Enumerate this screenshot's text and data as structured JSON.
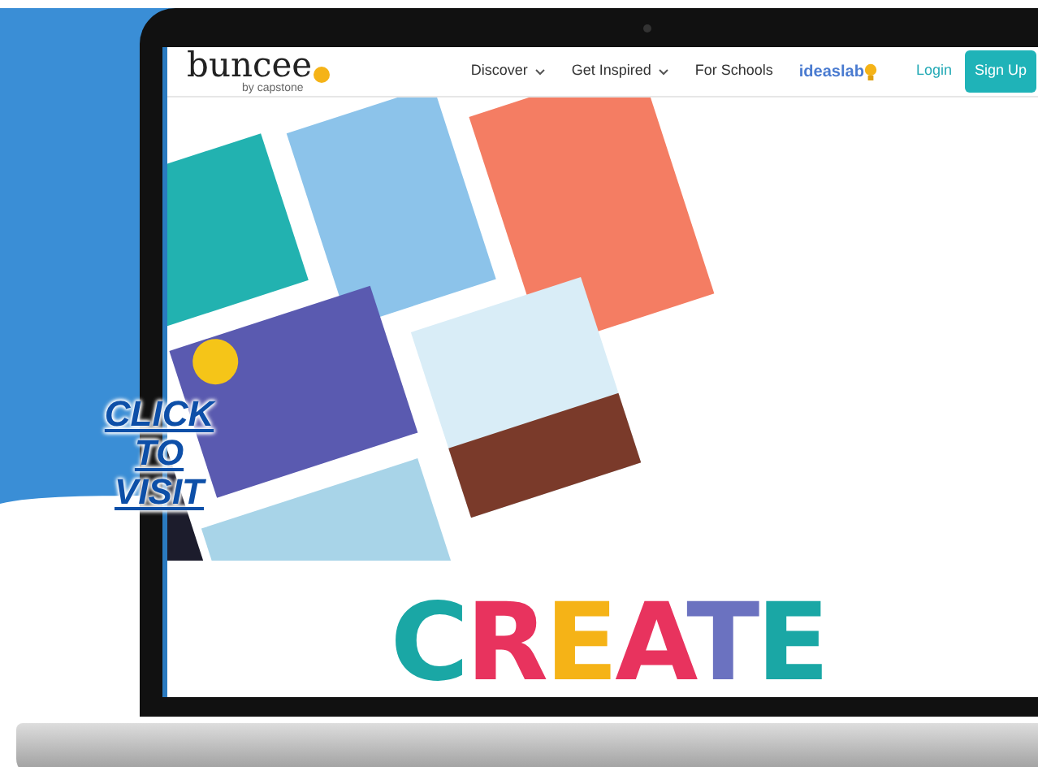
{
  "overlay_link": {
    "text": "CLICK TO VISIT"
  },
  "site": {
    "logo": "buncee",
    "logo_tagline": "by capstone",
    "nav": [
      {
        "label": "Discover",
        "kind": "dropdown"
      },
      {
        "label": "Get Inspired",
        "kind": "dropdown"
      },
      {
        "label": "For Schools",
        "kind": "link"
      },
      {
        "label": "ideaslab",
        "kind": "brand"
      }
    ],
    "login": "Login",
    "signup": "Sign Up",
    "hero_title": "CREATE"
  }
}
